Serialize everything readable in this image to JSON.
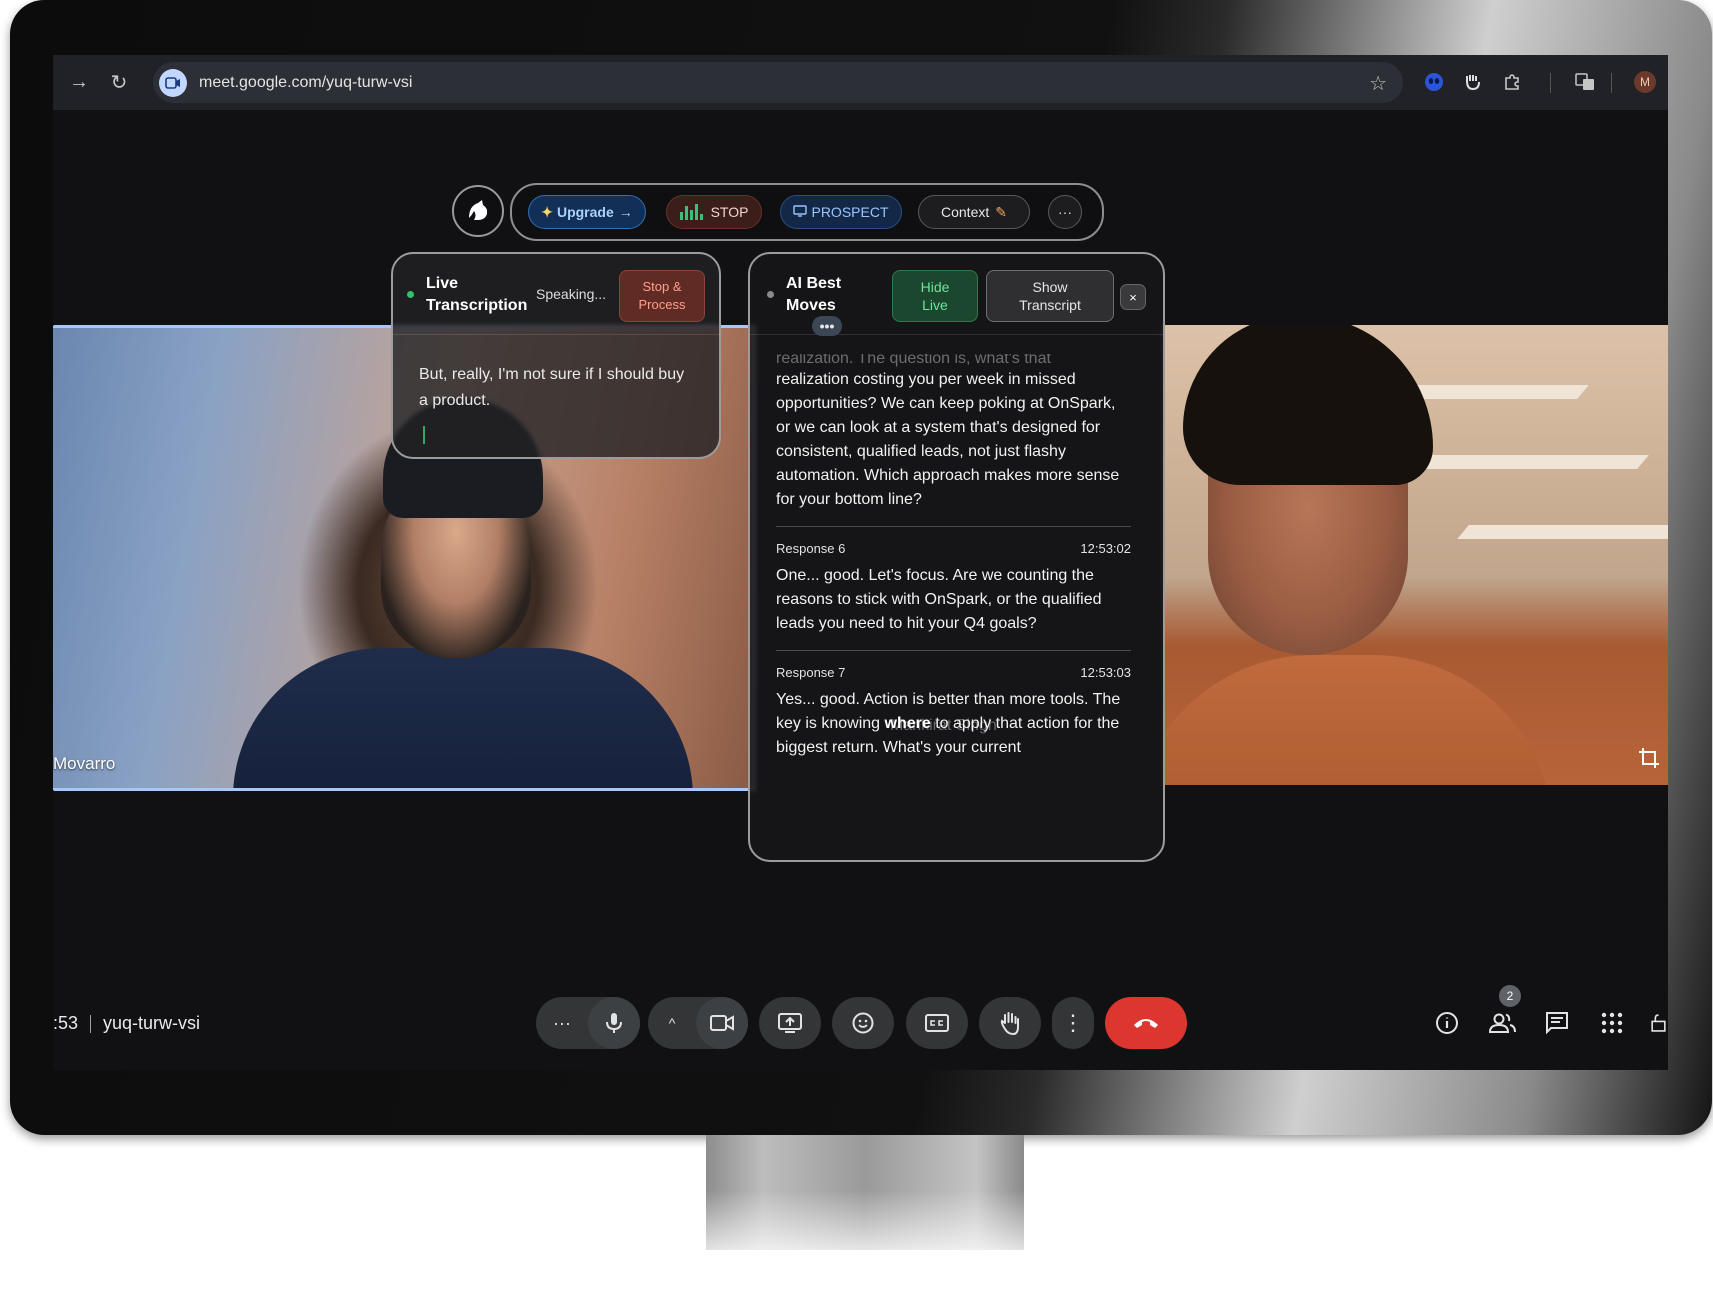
{
  "browser": {
    "url": "meet.google.com/yuq-turw-vsi",
    "profile_initial": "M"
  },
  "extension": {
    "upgrade_label": "Upgrade",
    "stop_label": "STOP",
    "prospect_label": "PROSPECT",
    "context_label": "Context",
    "more_label": "···"
  },
  "live_panel": {
    "title_line1": "Live",
    "title_line2": "Transcription",
    "status": "Speaking...",
    "stop_process_line1": "Stop &",
    "stop_process_line2": "Process",
    "transcript": "But, really, I'm not sure if I should buy a product."
  },
  "ai_panel": {
    "title_line1": "AI Best",
    "title_line2": "Moves",
    "hide_live_line1": "Hide",
    "hide_live_line2": "Live",
    "show_transcript_line1": "Show",
    "show_transcript_line2": "Transcript",
    "close_label": "×",
    "ellipsis": "•••",
    "faded_top": "realization. The question is, what's that",
    "response_prev_text": "realization costing you per week in missed opportunities? We can keep poking at OnSpark, or we can look at a system that's designed for consistent, qualified leads, not just flashy automation. Which approach makes more sense for your bottom line?",
    "responses": [
      {
        "label": "Response 6",
        "time": "12:53:02",
        "text": "One... good. Let's focus. Are we counting the reasons to stick with OnSpark, or the qualified leads you need to hit your Q4 goals?"
      },
      {
        "label": "Response 7",
        "time": "12:53:03",
        "text_before": "Yes... good. Action is better than more tools. The key is knowing ",
        "text_bold": "where",
        "text_after": " to apply that action for the biggest return. What's your current"
      }
    ]
  },
  "participants": {
    "left_name": "Movarro",
    "right_overlay_name": "Mankirat Singh"
  },
  "meeting": {
    "time": ":53",
    "code": "yuq-turw-vsi",
    "participant_count": "2"
  },
  "icons": {
    "forward": "→",
    "reload": "↻",
    "star": "☆",
    "more_horiz": "···",
    "mic": "mic-icon",
    "chevron_up": "^",
    "camera": "camera-icon",
    "present": "present-icon",
    "emoji": "☺",
    "captions": "CC",
    "raise_hand": "hand-icon",
    "more_vert": "⋮",
    "end_call": "phone-icon",
    "info": "ⓘ",
    "chat": "chat-icon",
    "apps": "grid-icon"
  }
}
